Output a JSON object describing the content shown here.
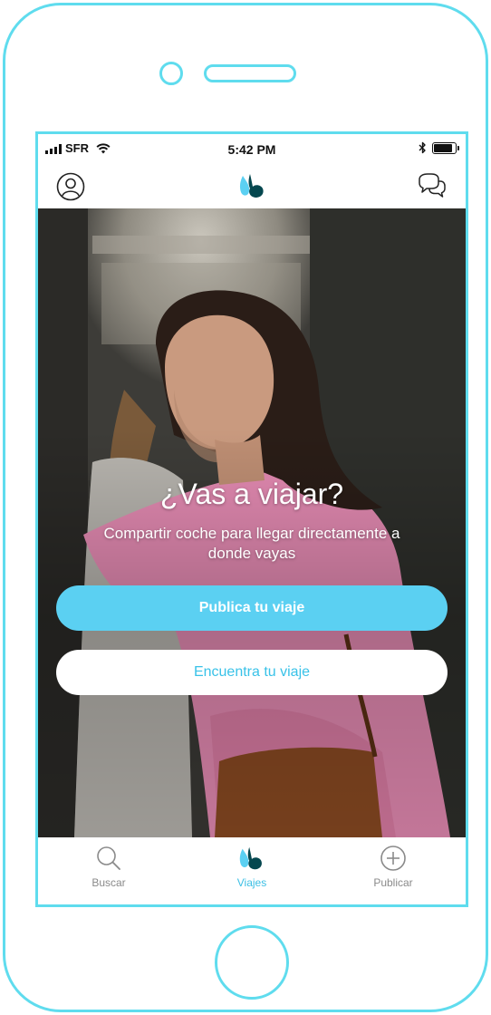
{
  "status_bar": {
    "carrier": "SFR",
    "time": "5:42 PM"
  },
  "header": {
    "profile_icon": "profile-icon",
    "logo_icon": "app-logo-icon",
    "chat_icon": "chat-bubbles-icon"
  },
  "hero": {
    "title": "¿Vas a viajar?",
    "subtitle": "Compartir coche para llegar directamente a donde vayas",
    "primary_button": "Publica tu viaje",
    "secondary_button": "Encuentra tu viaje"
  },
  "tab_bar": {
    "items": [
      {
        "label": "Buscar",
        "icon": "search-icon",
        "active": false
      },
      {
        "label": "Viajes",
        "icon": "app-logo-icon",
        "active": true
      },
      {
        "label": "Publicar",
        "icon": "plus-circle-icon",
        "active": false
      }
    ]
  },
  "colors": {
    "frame": "#5fdcee",
    "accent": "#5bd0f2",
    "logo_dark": "#05474f",
    "logo_light": "#5bd0f2"
  }
}
